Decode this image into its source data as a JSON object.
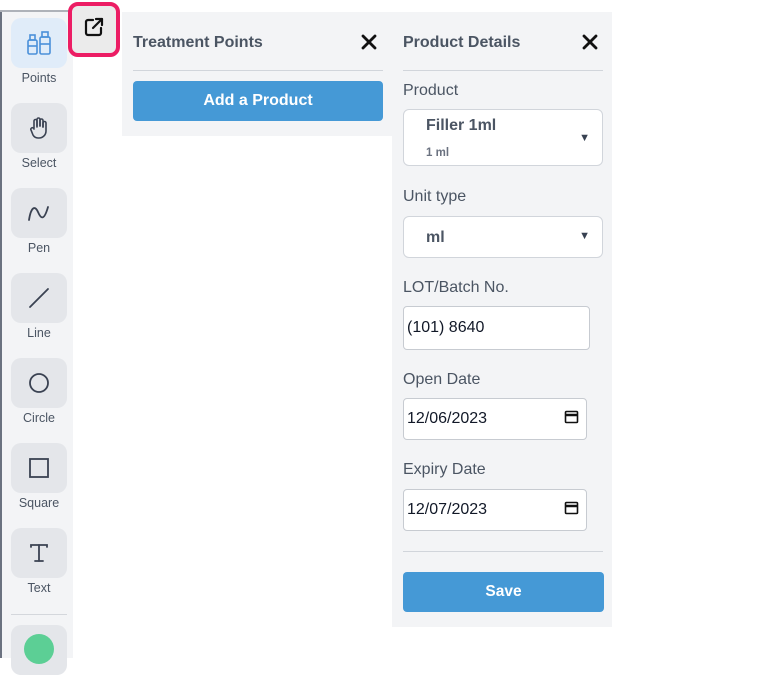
{
  "toolbar": {
    "tools": [
      {
        "label": "Points",
        "icon": "bottles-icon",
        "active": true
      },
      {
        "label": "Select",
        "icon": "hand-icon"
      },
      {
        "label": "Pen",
        "icon": "pen-curve-icon"
      },
      {
        "label": "Line",
        "icon": "line-icon"
      },
      {
        "label": "Circle",
        "icon": "circle-icon"
      },
      {
        "label": "Square",
        "icon": "square-icon"
      },
      {
        "label": "Text",
        "icon": "text-icon"
      }
    ],
    "color": "#5ccf95"
  },
  "popout": {
    "icon": "external-link-icon",
    "highlight_color": "#ec1d64"
  },
  "treatment_points": {
    "title": "Treatment Points",
    "add_product_label": "Add a Product"
  },
  "product_details": {
    "title": "Product Details",
    "product_label": "Product",
    "product_value": "Filler 1ml",
    "product_sub": "1 ml",
    "unit_type_label": "Unit type",
    "unit_type_value": "ml",
    "lot_label": "LOT/Batch No.",
    "lot_value": "(101) 8640",
    "open_date_label": "Open Date",
    "open_date_value": "12/06/2023",
    "expiry_date_label": "Expiry Date",
    "expiry_date_value": "12/07/2023",
    "save_label": "Save"
  },
  "colors": {
    "accent": "#4599d6",
    "panel": "#f3f4f6"
  }
}
